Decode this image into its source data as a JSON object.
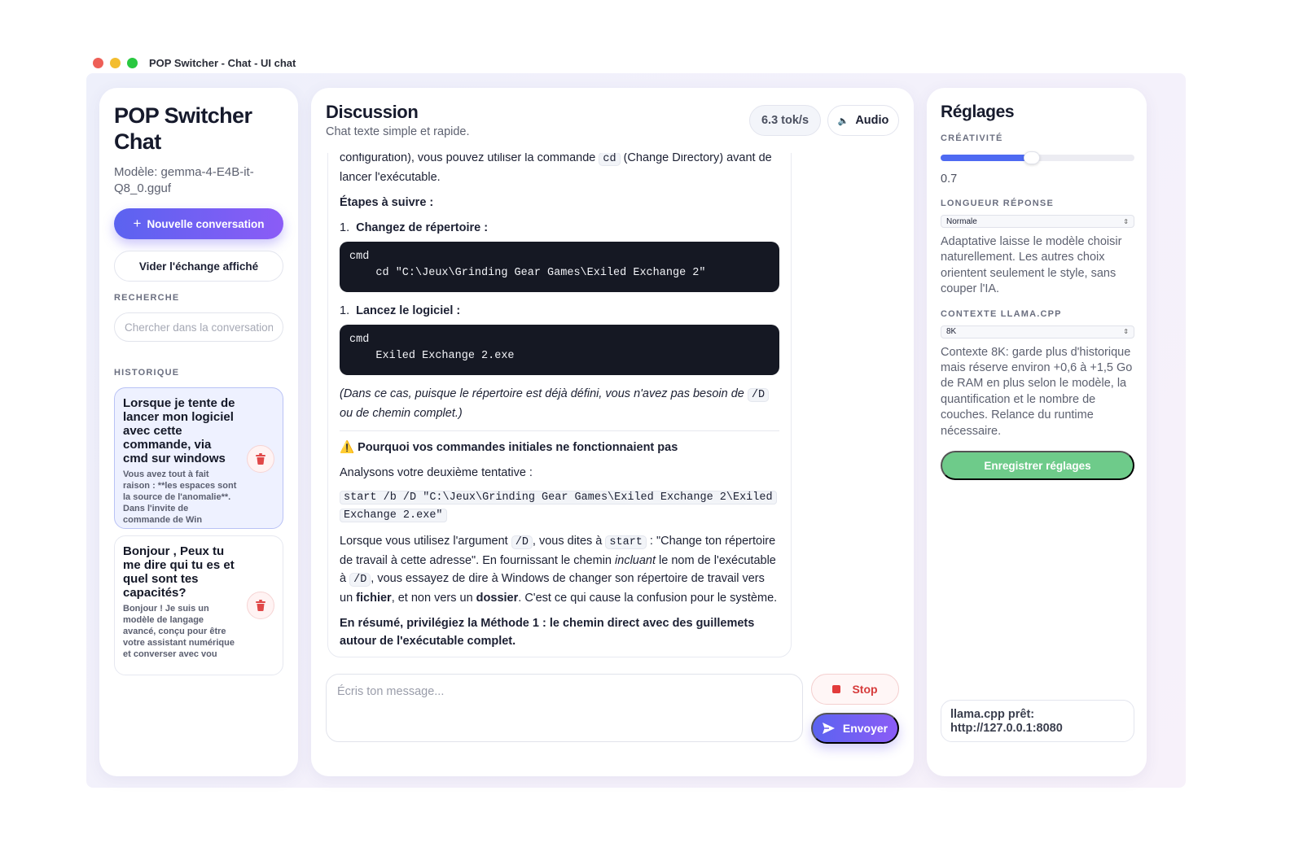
{
  "window": {
    "title": "POP Switcher - Chat - UI chat"
  },
  "sidebar": {
    "app_title": "POP Switcher Chat",
    "model": "Modèle: gemma-4-E4B-it-Q8_0.gguf",
    "new_conversation": "Nouvelle conversation",
    "clear_button": "Vider l'échange affiché",
    "search_label": "RECHERCHE",
    "search_placeholder": "Chercher dans la conversation",
    "history_label": "HISTORIQUE",
    "history": [
      {
        "title": "Lorsque je tente de lancer mon logiciel avec cette commande, via cmd sur windows",
        "snippet": "Vous avez tout à fait raison : **les espaces sont la source de l'anomalie**. Dans l'invite de commande de Win"
      },
      {
        "title": "Bonjour , Peux tu me dire qui tu es et quel sont tes capacités?",
        "snippet": "Bonjour ! Je suis un modèle de langage avancé, conçu pour être votre assistant numérique et converser avec vou"
      }
    ]
  },
  "chat": {
    "title": "Discussion",
    "subtitle": "Chat texte simple et rapide.",
    "speed": "6.3 tok/s",
    "audio_label": "Audio",
    "message": {
      "line1_pre": "configuration), vous pouvez utiliser la commande ",
      "line1_code": "cd",
      "line1_post": " (Change Directory) avant de lancer l'exécutable.",
      "steps_heading": "Étapes à suivre :",
      "step1_num": "1.",
      "step1": "Changez de répertoire :",
      "code1": "cmd\n    cd \"C:\\Jeux\\Grinding Gear Games\\Exiled Exchange 2\"",
      "step2_num": "1.",
      "step2": "Lancez le logiciel :",
      "code2": "cmd\n    Exiled Exchange 2.exe",
      "note_pre": "(Dans ce cas, puisque le répertoire est déjà défini, vous n'avez pas besoin de ",
      "note_code": "/D",
      "note_post": " ou de chemin complet.)",
      "warn_icon": "⚠️",
      "warn_heading": "Pourquoi vos commandes initiales ne fonctionnaient pas",
      "analysis": "Analysons votre deuxième tentative :",
      "command_line1": "start /b /D \"C:\\Jeux\\Grinding Gear Games\\Exiled Exchange 2\\Exiled",
      "command_line2": "Exchange 2.exe\"",
      "p1_a": "Lorsque vous utilisez l'argument ",
      "p1_code1": "/D",
      "p1_b": ", vous dites à ",
      "p1_code2": "start",
      "p1_c": " : \"Change ton répertoire de travail à cette adresse\". En fournissant le chemin ",
      "p1_em": "incluant",
      "p1_d": " le nom de l'exécutable à ",
      "p1_code3": "/D",
      "p1_e": ", vous essayez de dire à Windows de changer son répertoire de travail vers un ",
      "p1_b1": "fichier",
      "p1_f": ", et non vers un ",
      "p1_b2": "dossier",
      "p1_g": ". C'est ce qui cause la confusion pour le système.",
      "summary": "En résumé, privilégiez la Méthode 1 : le chemin direct avec des guillemets autour de l'exécutable complet."
    },
    "composer_placeholder": "Écris ton message...",
    "stop_label": "Stop",
    "send_label": "Envoyer"
  },
  "settings": {
    "title": "Réglages",
    "creativity_label": "CRÉATIVITÉ",
    "creativity_value": "0.7",
    "creativity_fraction": 0.47,
    "length_label": "LONGUEUR RÉPONSE",
    "length_selected": "Normale",
    "length_desc": "Adaptative laisse le modèle choisir naturellement. Les autres choix orientent seulement le style, sans couper l'IA.",
    "context_label": "CONTEXTE LLAMA.CPP",
    "context_selected": "8K",
    "context_desc": "Contexte 8K: garde plus d'historique mais réserve environ +0,6 à +1,5 Go de RAM en plus selon le modèle, la quantification et le nombre de couches. Relance du runtime nécessaire.",
    "save_label": "Enregistrer réglages",
    "status": "llama.cpp prêt: http://127.0.0.1:8080"
  },
  "colors": {
    "accent": "#5b63f0",
    "accent2": "#8b5cf6",
    "save": "#6ecb8a",
    "danger": "#e23b3b"
  },
  "icons": [
    "plus-icon",
    "trash-icon",
    "speaker-icon",
    "stop-icon",
    "send-icon",
    "warning-icon",
    "chevron-updown-icon"
  ]
}
